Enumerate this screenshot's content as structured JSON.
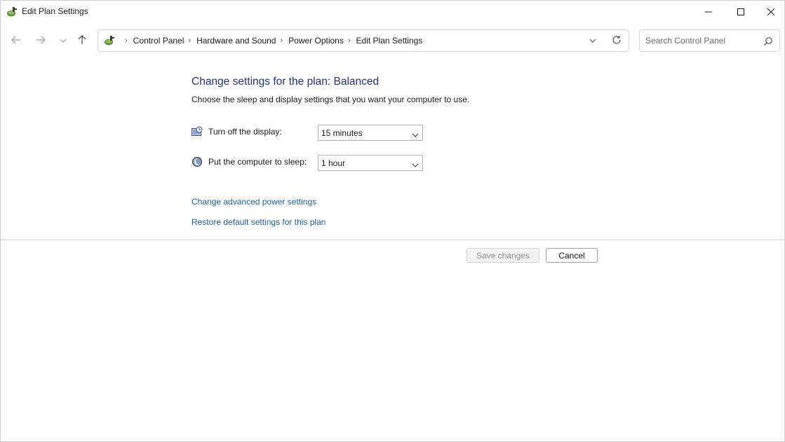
{
  "window": {
    "title": "Edit Plan Settings",
    "app_icon": "power-options-icon"
  },
  "titlebar_controls": {
    "minimize_icon": "minimize-icon",
    "maximize_icon": "maximize-icon",
    "close_icon": "close-icon"
  },
  "navigation": {
    "back_icon": "arrow-left-icon",
    "forward_icon": "arrow-right-icon",
    "recent_icon": "chevron-down-icon",
    "up_icon": "arrow-up-icon"
  },
  "address_bar": {
    "icon": "control-panel-icon",
    "breadcrumbs": [
      "Control Panel",
      "Hardware and Sound",
      "Power Options",
      "Edit Plan Settings"
    ],
    "separator": "›",
    "dropdown_icon": "chevron-down-icon",
    "refresh_icon": "refresh-icon"
  },
  "search": {
    "placeholder": "Search Control Panel",
    "value": "",
    "icon": "search-icon"
  },
  "main": {
    "heading": "Change settings for the plan: Balanced",
    "subheading": "Choose the sleep and display settings that you want your computer to use.",
    "settings": [
      {
        "label": "Turn off the display:",
        "value": "15 minutes",
        "icon": "display-timer-icon"
      },
      {
        "label": "Put the computer to sleep:",
        "value": "1 hour",
        "icon": "sleep-moon-icon"
      }
    ],
    "links": {
      "advanced": "Change advanced power settings",
      "restore": "Restore default settings for this plan"
    },
    "buttons": {
      "save": "Save changes",
      "cancel": "Cancel"
    }
  },
  "colors": {
    "heading": "#1e3287",
    "link": "#1c5fa8",
    "disabled_text": "#8f8f8f"
  }
}
